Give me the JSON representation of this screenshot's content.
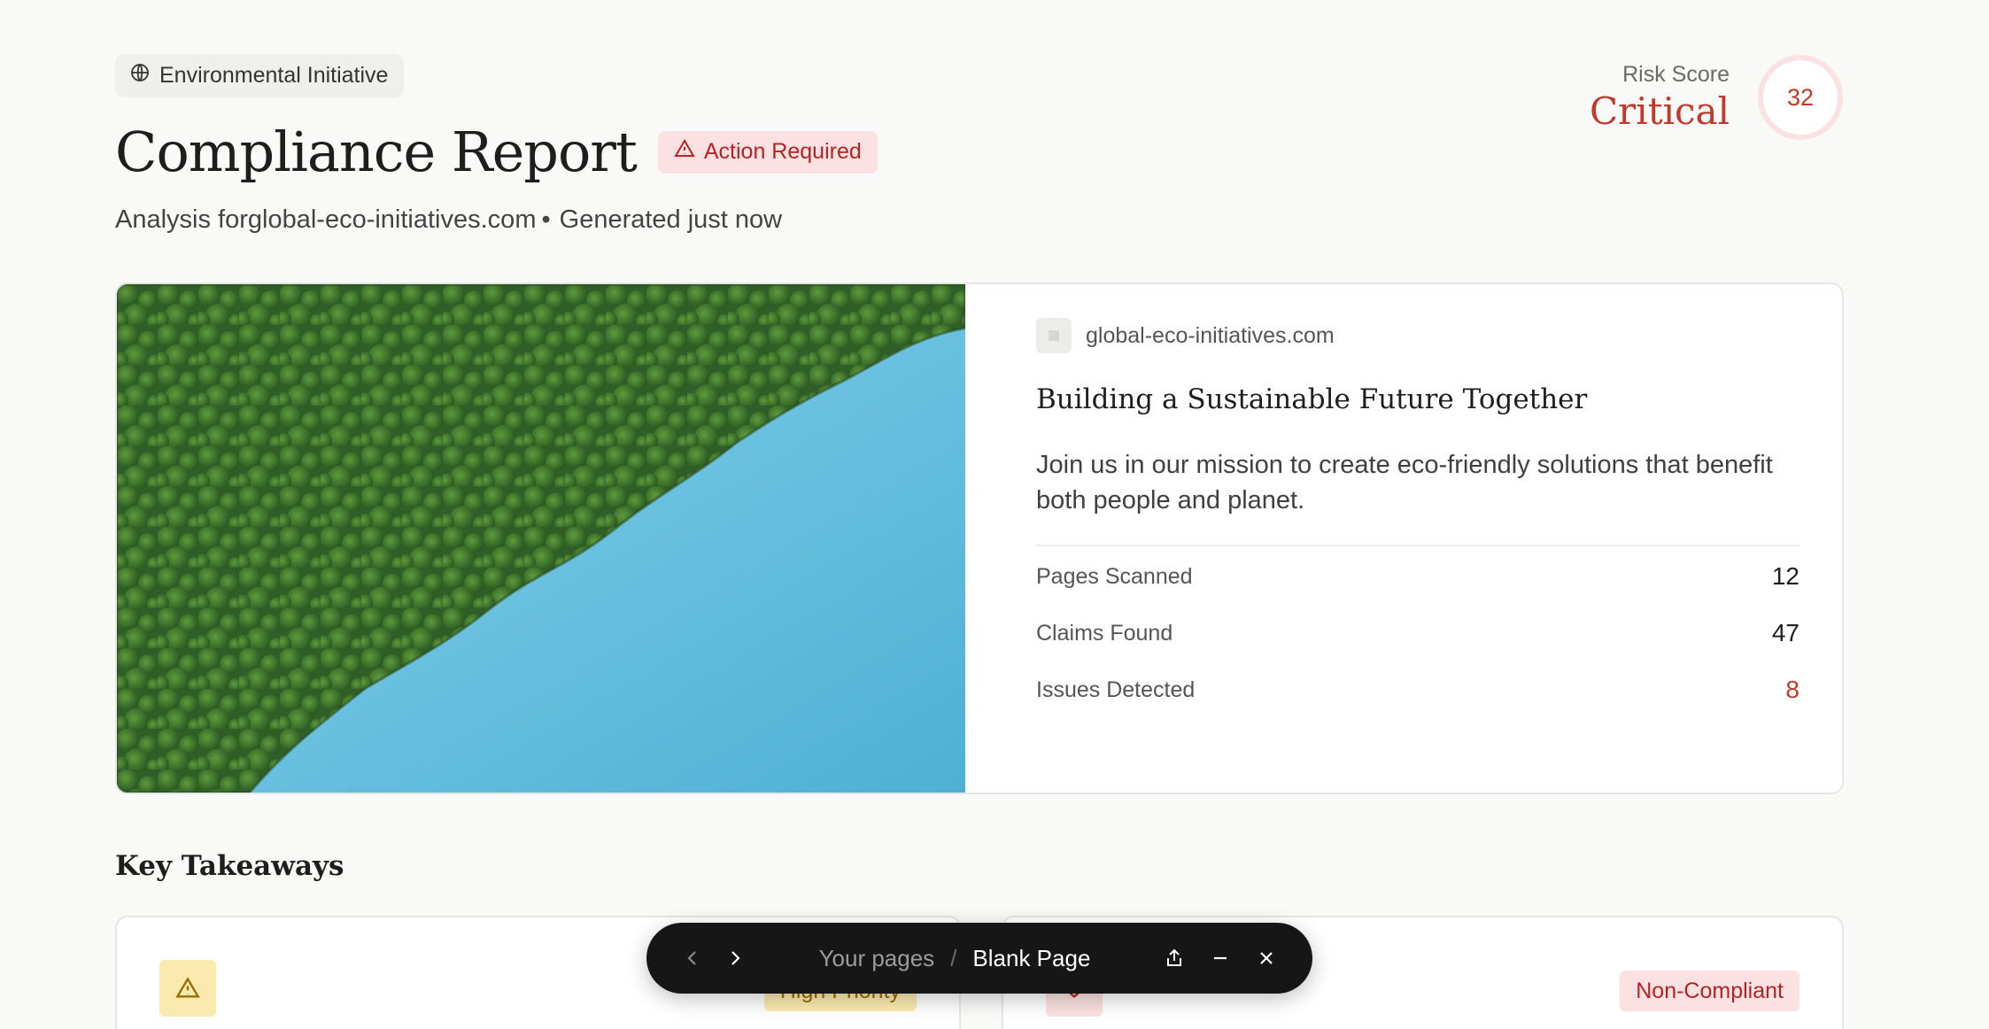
{
  "header": {
    "initiative_label": "Environmental Initiative",
    "title": "Compliance Report",
    "action_badge": "Action Required",
    "subtitle_analysis": "Analysis forglobal-eco-initiatives.com",
    "subtitle_dot": "•",
    "subtitle_generated": "Generated just now"
  },
  "risk": {
    "label": "Risk Score",
    "level": "Critical",
    "score": "32"
  },
  "site": {
    "domain": "global-eco-initiatives.com",
    "headline": "Building a Sustainable Future Together",
    "description": "Join us in our mission to create eco-friendly solutions that benefit both people and planet.",
    "stats": [
      {
        "label": "Pages Scanned",
        "value": "12"
      },
      {
        "label": "Claims Found",
        "value": "47"
      },
      {
        "label": "Issues Detected",
        "value": "8"
      }
    ]
  },
  "takeaways": {
    "title": "Key Takeaways",
    "cards": [
      {
        "icon": "warning-icon",
        "badge": "High Priority"
      },
      {
        "icon": "heart-icon",
        "badge": "Non-Compliant"
      }
    ]
  },
  "floating_bar": {
    "crumb_root": "Your pages",
    "crumb_sep": "/",
    "crumb_current": "Blank Page"
  },
  "colors": {
    "critical": "#c0392b",
    "critical_bg": "#fbe1e1",
    "warning_bg": "#fbeab0",
    "bar_bg": "#161616"
  }
}
